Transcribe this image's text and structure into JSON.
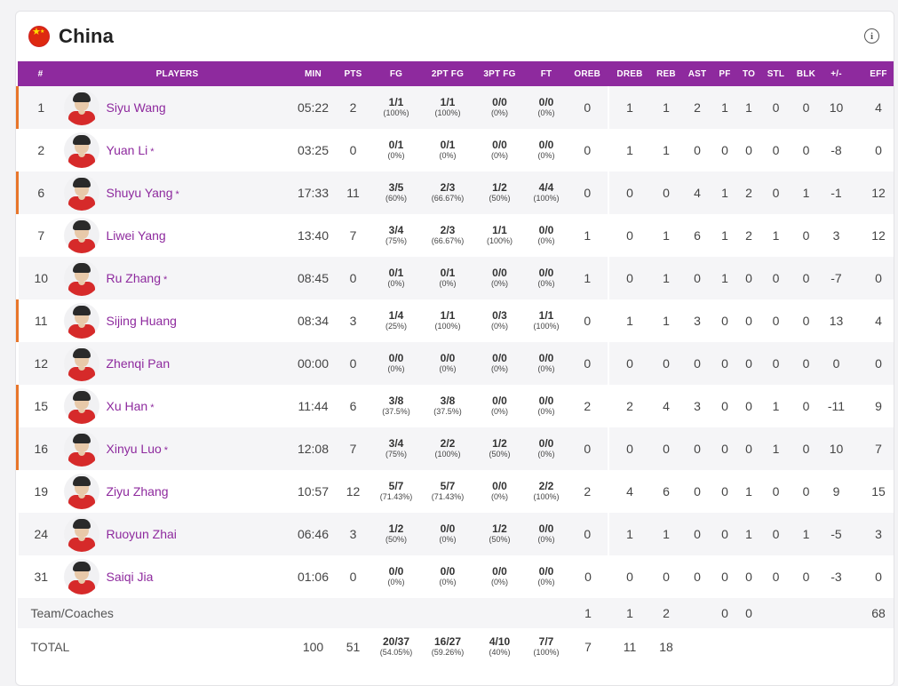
{
  "team": {
    "name": "China",
    "flag_icon": "china-flag-icon",
    "info_icon": "info-icon"
  },
  "columns": [
    "#",
    "PLAYERS",
    "MIN",
    "PTS",
    "FG",
    "2PT FG",
    "3PT FG",
    "FT",
    "OREB",
    "DREB",
    "REB",
    "AST",
    "PF",
    "TO",
    "STL",
    "BLK",
    "+/-",
    "EFF"
  ],
  "players": [
    {
      "num": "1",
      "name": "Siyu Wang",
      "star": false,
      "started": true,
      "min": "05:22",
      "pts": "2",
      "fg": "1/1",
      "fg_pct": "(100%)",
      "fg2": "1/1",
      "fg2_pct": "(100%)",
      "fg3": "0/0",
      "fg3_pct": "(0%)",
      "ft": "0/0",
      "ft_pct": "(0%)",
      "oreb": "0",
      "dreb": "1",
      "reb": "1",
      "ast": "2",
      "pf": "1",
      "to": "1",
      "stl": "0",
      "blk": "0",
      "pm": "10",
      "eff": "4"
    },
    {
      "num": "2",
      "name": "Yuan Li",
      "star": true,
      "started": false,
      "min": "03:25",
      "pts": "0",
      "fg": "0/1",
      "fg_pct": "(0%)",
      "fg2": "0/1",
      "fg2_pct": "(0%)",
      "fg3": "0/0",
      "fg3_pct": "(0%)",
      "ft": "0/0",
      "ft_pct": "(0%)",
      "oreb": "0",
      "dreb": "1",
      "reb": "1",
      "ast": "0",
      "pf": "0",
      "to": "0",
      "stl": "0",
      "blk": "0",
      "pm": "-8",
      "eff": "0"
    },
    {
      "num": "6",
      "name": "Shuyu Yang",
      "star": true,
      "started": true,
      "min": "17:33",
      "pts": "11",
      "fg": "3/5",
      "fg_pct": "(60%)",
      "fg2": "2/3",
      "fg2_pct": "(66.67%)",
      "fg3": "1/2",
      "fg3_pct": "(50%)",
      "ft": "4/4",
      "ft_pct": "(100%)",
      "oreb": "0",
      "dreb": "0",
      "reb": "0",
      "ast": "4",
      "pf": "1",
      "to": "2",
      "stl": "0",
      "blk": "1",
      "pm": "-1",
      "eff": "12"
    },
    {
      "num": "7",
      "name": "Liwei Yang",
      "star": false,
      "started": false,
      "min": "13:40",
      "pts": "7",
      "fg": "3/4",
      "fg_pct": "(75%)",
      "fg2": "2/3",
      "fg2_pct": "(66.67%)",
      "fg3": "1/1",
      "fg3_pct": "(100%)",
      "ft": "0/0",
      "ft_pct": "(0%)",
      "oreb": "1",
      "dreb": "0",
      "reb": "1",
      "ast": "6",
      "pf": "1",
      "to": "2",
      "stl": "1",
      "blk": "0",
      "pm": "3",
      "eff": "12"
    },
    {
      "num": "10",
      "name": "Ru Zhang",
      "star": true,
      "started": false,
      "min": "08:45",
      "pts": "0",
      "fg": "0/1",
      "fg_pct": "(0%)",
      "fg2": "0/1",
      "fg2_pct": "(0%)",
      "fg3": "0/0",
      "fg3_pct": "(0%)",
      "ft": "0/0",
      "ft_pct": "(0%)",
      "oreb": "1",
      "dreb": "0",
      "reb": "1",
      "ast": "0",
      "pf": "1",
      "to": "0",
      "stl": "0",
      "blk": "0",
      "pm": "-7",
      "eff": "0"
    },
    {
      "num": "11",
      "name": "Sijing Huang",
      "star": false,
      "started": true,
      "min": "08:34",
      "pts": "3",
      "fg": "1/4",
      "fg_pct": "(25%)",
      "fg2": "1/1",
      "fg2_pct": "(100%)",
      "fg3": "0/3",
      "fg3_pct": "(0%)",
      "ft": "1/1",
      "ft_pct": "(100%)",
      "oreb": "0",
      "dreb": "1",
      "reb": "1",
      "ast": "3",
      "pf": "0",
      "to": "0",
      "stl": "0",
      "blk": "0",
      "pm": "13",
      "eff": "4"
    },
    {
      "num": "12",
      "name": "Zhenqi Pan",
      "star": false,
      "started": false,
      "min": "00:00",
      "pts": "0",
      "fg": "0/0",
      "fg_pct": "(0%)",
      "fg2": "0/0",
      "fg2_pct": "(0%)",
      "fg3": "0/0",
      "fg3_pct": "(0%)",
      "ft": "0/0",
      "ft_pct": "(0%)",
      "oreb": "0",
      "dreb": "0",
      "reb": "0",
      "ast": "0",
      "pf": "0",
      "to": "0",
      "stl": "0",
      "blk": "0",
      "pm": "0",
      "eff": "0"
    },
    {
      "num": "15",
      "name": "Xu Han",
      "star": true,
      "started": true,
      "min": "11:44",
      "pts": "6",
      "fg": "3/8",
      "fg_pct": "(37.5%)",
      "fg2": "3/8",
      "fg2_pct": "(37.5%)",
      "fg3": "0/0",
      "fg3_pct": "(0%)",
      "ft": "0/0",
      "ft_pct": "(0%)",
      "oreb": "2",
      "dreb": "2",
      "reb": "4",
      "ast": "3",
      "pf": "0",
      "to": "0",
      "stl": "1",
      "blk": "0",
      "pm": "-11",
      "eff": "9"
    },
    {
      "num": "16",
      "name": "Xinyu Luo",
      "star": true,
      "started": true,
      "min": "12:08",
      "pts": "7",
      "fg": "3/4",
      "fg_pct": "(75%)",
      "fg2": "2/2",
      "fg2_pct": "(100%)",
      "fg3": "1/2",
      "fg3_pct": "(50%)",
      "ft": "0/0",
      "ft_pct": "(0%)",
      "oreb": "0",
      "dreb": "0",
      "reb": "0",
      "ast": "0",
      "pf": "0",
      "to": "0",
      "stl": "1",
      "blk": "0",
      "pm": "10",
      "eff": "7"
    },
    {
      "num": "19",
      "name": "Ziyu Zhang",
      "star": false,
      "started": false,
      "min": "10:57",
      "pts": "12",
      "fg": "5/7",
      "fg_pct": "(71.43%)",
      "fg2": "5/7",
      "fg2_pct": "(71.43%)",
      "fg3": "0/0",
      "fg3_pct": "(0%)",
      "ft": "2/2",
      "ft_pct": "(100%)",
      "oreb": "2",
      "dreb": "4",
      "reb": "6",
      "ast": "0",
      "pf": "0",
      "to": "1",
      "stl": "0",
      "blk": "0",
      "pm": "9",
      "eff": "15"
    },
    {
      "num": "24",
      "name": "Ruoyun Zhai",
      "star": false,
      "started": false,
      "min": "06:46",
      "pts": "3",
      "fg": "1/2",
      "fg_pct": "(50%)",
      "fg2": "0/0",
      "fg2_pct": "(0%)",
      "fg3": "1/2",
      "fg3_pct": "(50%)",
      "ft": "0/0",
      "ft_pct": "(0%)",
      "oreb": "0",
      "dreb": "1",
      "reb": "1",
      "ast": "0",
      "pf": "0",
      "to": "1",
      "stl": "0",
      "blk": "1",
      "pm": "-5",
      "eff": "3"
    },
    {
      "num": "31",
      "name": "Saiqi Jia",
      "star": false,
      "started": false,
      "min": "01:06",
      "pts": "0",
      "fg": "0/0",
      "fg_pct": "(0%)",
      "fg2": "0/0",
      "fg2_pct": "(0%)",
      "fg3": "0/0",
      "fg3_pct": "(0%)",
      "ft": "0/0",
      "ft_pct": "(0%)",
      "oreb": "0",
      "dreb": "0",
      "reb": "0",
      "ast": "0",
      "pf": "0",
      "to": "0",
      "stl": "0",
      "blk": "0",
      "pm": "-3",
      "eff": "0"
    }
  ],
  "team_coaches": {
    "label": "Team/Coaches",
    "oreb": "1",
    "dreb": "1",
    "reb": "2",
    "pf": "0",
    "to": "0",
    "eff": "68"
  },
  "total": {
    "label": "TOTAL",
    "min": "100",
    "pts": "51",
    "fg": "20/37",
    "fg_pct": "(54.05%)",
    "fg2": "16/27",
    "fg2_pct": "(59.26%)",
    "fg3": "4/10",
    "fg3_pct": "(40%)",
    "ft": "7/7",
    "ft_pct": "(100%)",
    "oreb": "7",
    "dreb": "11",
    "reb": "18"
  },
  "colors": {
    "header_bg": "#8e2a9e",
    "player_name": "#8e2a9e",
    "starter_marker": "#e8762b"
  }
}
